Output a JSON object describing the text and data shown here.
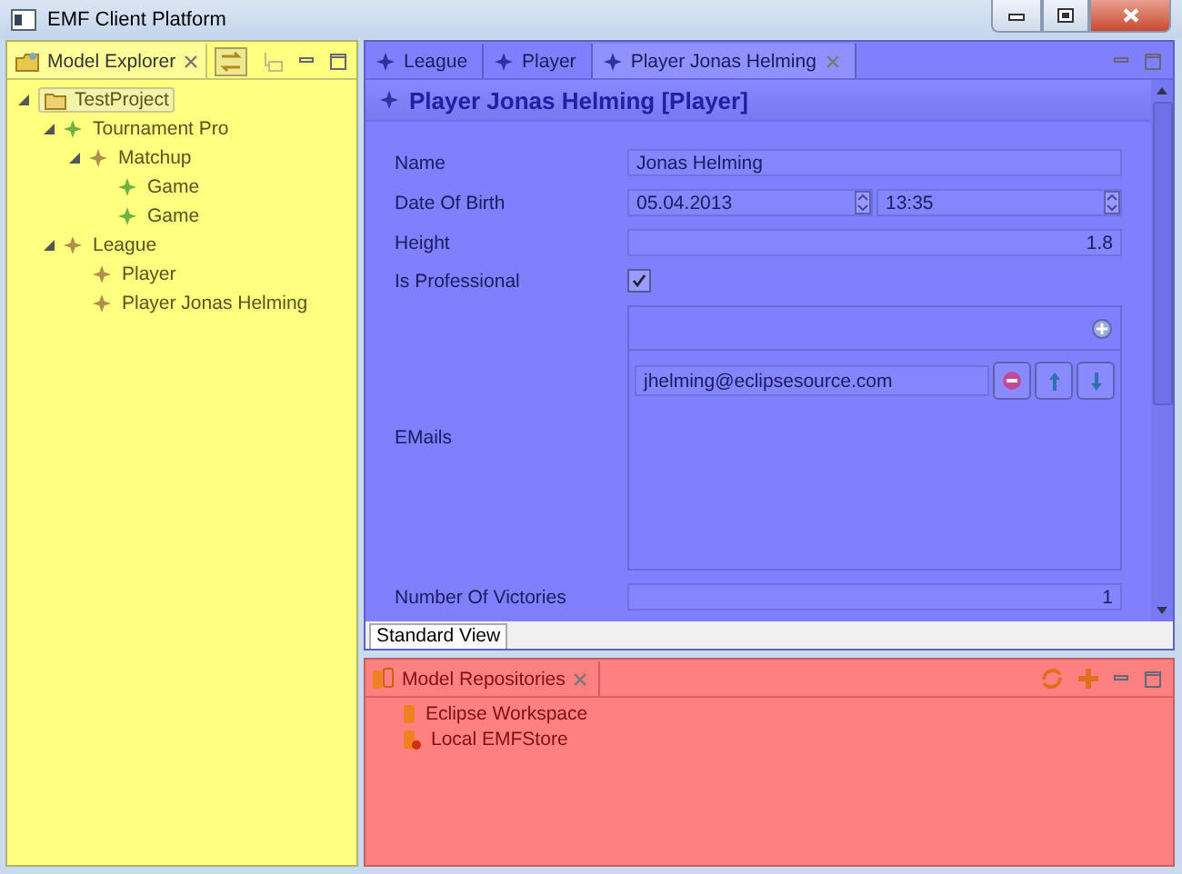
{
  "window": {
    "title": "EMF Client Platform"
  },
  "model_explorer": {
    "title": "Model Explorer",
    "tree": [
      {
        "label": "TestProject",
        "kind": "project",
        "selected": true,
        "expanded": true,
        "children": [
          {
            "label": "Tournament Pro",
            "kind": "element",
            "color": "#70b040",
            "selected": false,
            "expanded": true,
            "children": [
              {
                "label": "Matchup",
                "kind": "element",
                "color": "#b09048",
                "selected": false,
                "expanded": true,
                "children": [
                  {
                    "label": "Game",
                    "kind": "element",
                    "color": "#70b040",
                    "selected": false
                  },
                  {
                    "label": "Game",
                    "kind": "element",
                    "color": "#70b040",
                    "selected": false
                  }
                ]
              }
            ]
          },
          {
            "label": "League",
            "kind": "element",
            "color": "#b09048",
            "selected": false,
            "expanded": true,
            "children": [
              {
                "label": "Player",
                "kind": "element",
                "color": "#b09048",
                "selected": false
              },
              {
                "label": "Player Jonas Helming",
                "kind": "element",
                "color": "#b09048",
                "selected": false
              }
            ]
          }
        ]
      }
    ]
  },
  "editor": {
    "tabs": [
      {
        "label": "League",
        "selected": false
      },
      {
        "label": "Player",
        "selected": false
      },
      {
        "label": "Player Jonas Helming",
        "selected": true
      }
    ],
    "heading": "Player Jonas Helming [Player]",
    "fields": [
      {
        "kind": "text",
        "label": "Name",
        "value": "Jonas Helming"
      },
      {
        "kind": "datetime",
        "label": "Date Of Birth",
        "date": "05.04.2013",
        "time": "13:35"
      },
      {
        "kind": "number",
        "label": "Height",
        "value": "1.8"
      },
      {
        "kind": "checkbox",
        "label": "Is Professional",
        "checked": true
      },
      {
        "kind": "list",
        "label": "EMails",
        "items": [
          "jhelming@eclipsesource.com"
        ]
      },
      {
        "kind": "number",
        "label": "Number Of Victories",
        "value": "1"
      }
    ],
    "view_tab": "Standard View"
  },
  "repositories": {
    "title": "Model Repositories",
    "items": [
      {
        "label": "Eclipse Workspace",
        "kind": "workspace"
      },
      {
        "label": "Local EMFStore",
        "kind": "store"
      }
    ]
  }
}
